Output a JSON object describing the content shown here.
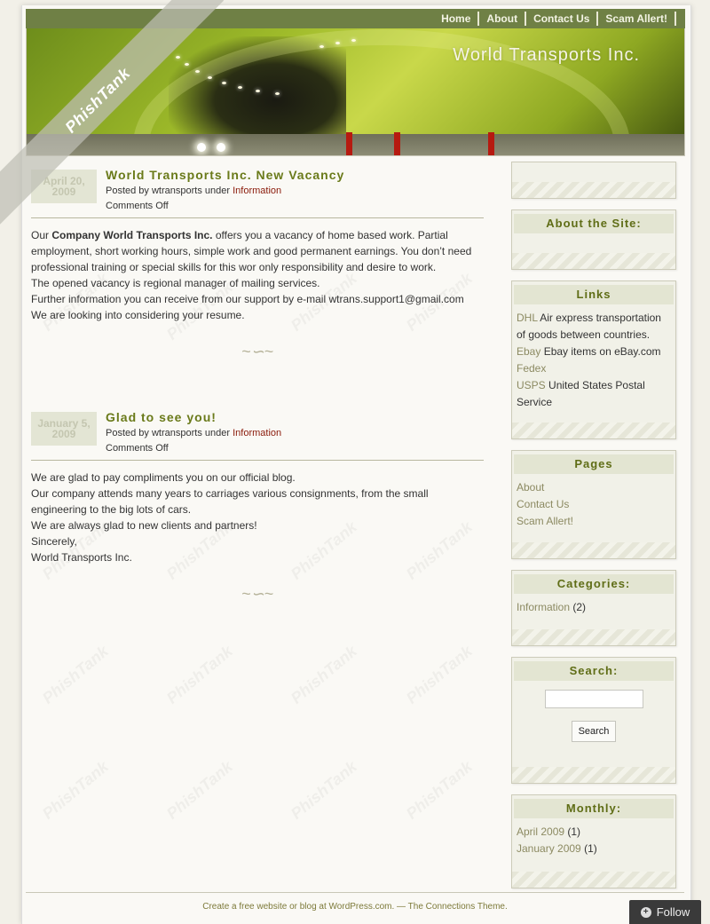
{
  "nav": {
    "items": [
      "Home",
      "About",
      "Contact Us",
      "Scam Allert!"
    ]
  },
  "site": {
    "title": "World Transports Inc."
  },
  "ribbon": {
    "label": "PhishTank"
  },
  "posts": [
    {
      "date": "April 20, 2009",
      "title": "World Transports Inc. New Vacancy",
      "meta_prefix": "Posted by wtransports under",
      "category": "Information",
      "comments": "Comments Off",
      "body_bold": "Company World Transports Inc.",
      "body_lead": "Our",
      "body_rest": " offers you a vacancy of home based work. Partial employment, short working hours, simple work and good permanent earnings. You don’t need professional training or special skills for this wor only responsibility and desire to work.",
      "body_lines": [
        "The opened vacancy is regional manager of mailing services.",
        "Further information you can receive from our support by e-mail wtrans.support1@gmail.com",
        "We are looking into considering your resume."
      ]
    },
    {
      "date": "January 5, 2009",
      "title": "Glad to see you!",
      "meta_prefix": "Posted by wtransports under",
      "category": "Information",
      "comments": "Comments Off",
      "body_lines": [
        "We are glad to pay compliments you on our official blog.",
        "Our company attends many years to carriages various consignments, from the small engineering to the big lots of cars.",
        "We are always glad to new clients and partners!",
        "Sincerely,",
        "World Transports Inc."
      ]
    }
  ],
  "sidebar": {
    "about_title": "About the Site:",
    "links_title": "Links",
    "links": [
      {
        "label": "DHL",
        "desc": "Air express transportation of goods between countries."
      },
      {
        "label": "Ebay",
        "desc": "Ebay items on eBay.com"
      },
      {
        "label": "Fedex",
        "desc": ""
      },
      {
        "label": "USPS",
        "desc": "United States Postal Service"
      }
    ],
    "pages_title": "Pages",
    "pages": [
      "About",
      "Contact Us",
      "Scam Allert!"
    ],
    "categories_title": "Categories:",
    "categories": [
      {
        "label": "Information",
        "count": "(2)"
      }
    ],
    "search_title": "Search:",
    "search_button": "Search",
    "monthly_title": "Monthly:",
    "monthly": [
      {
        "label": "April 2009",
        "count": "(1)"
      },
      {
        "label": "January 2009",
        "count": "(1)"
      }
    ]
  },
  "footer": {
    "text": "Create a free website or blog at WordPress.com. — The Connections Theme."
  },
  "follow": {
    "label": "Follow"
  },
  "colors": {
    "accent": "#6a7a1a",
    "category": "#8a1a0a",
    "link": "#8c8a62",
    "nav_bg": "#6f8045"
  }
}
